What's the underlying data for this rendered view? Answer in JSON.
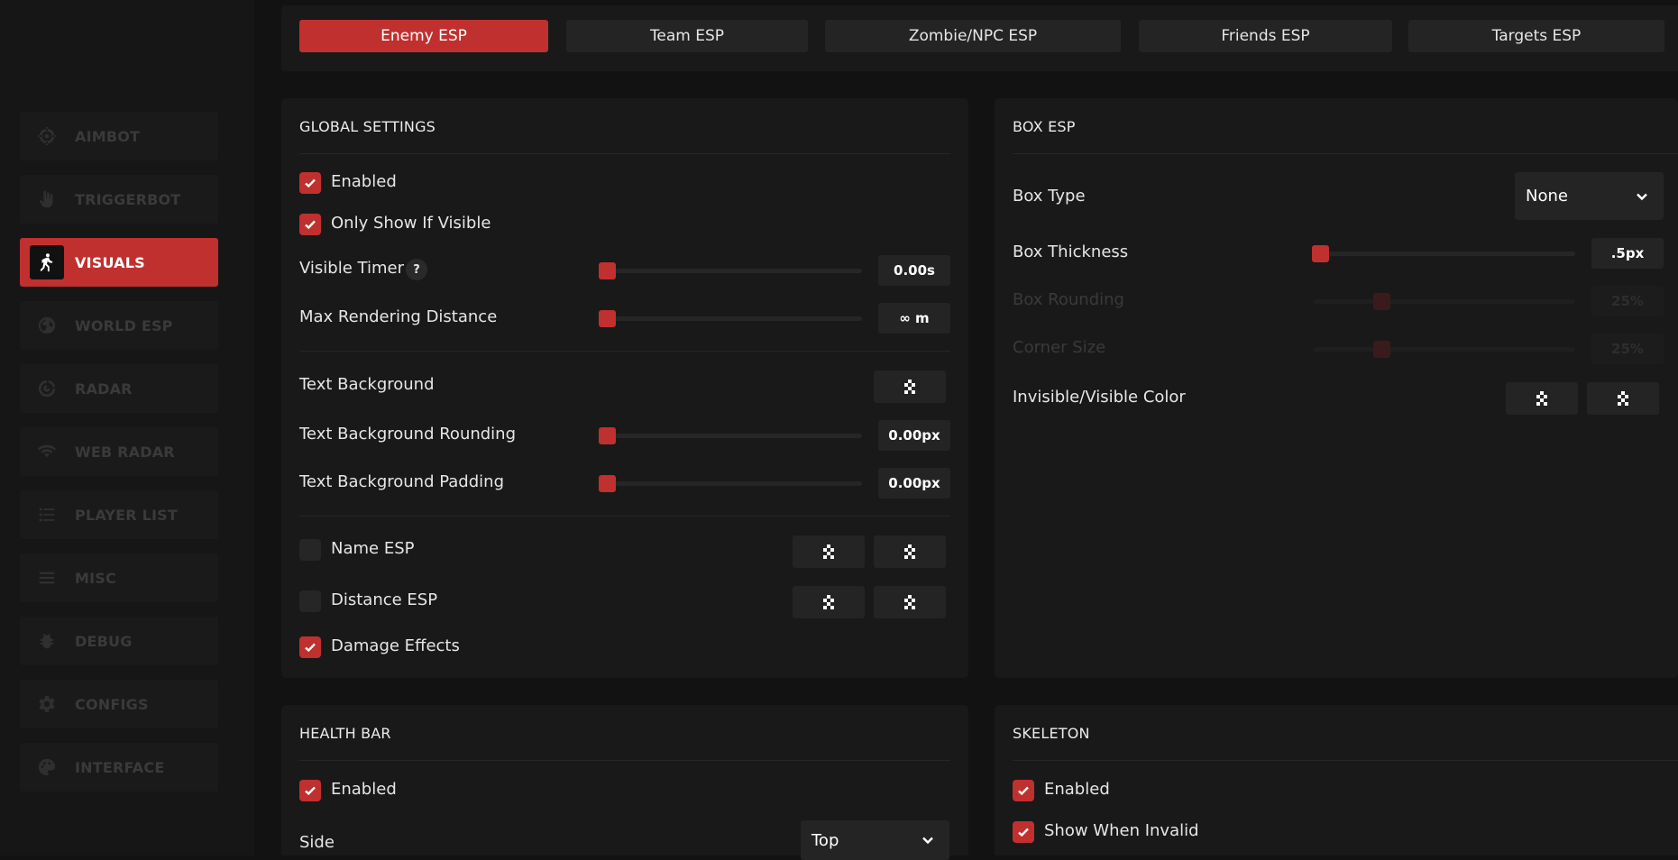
{
  "sidebar": {
    "items": [
      {
        "label": "AIMBOT",
        "icon": "crosshair-icon"
      },
      {
        "label": "TRIGGERBOT",
        "icon": "trigger-hand-icon"
      },
      {
        "label": "VISUALS",
        "icon": "walking-person-icon",
        "active": true
      },
      {
        "label": "WORLD ESP",
        "icon": "globe-icon"
      },
      {
        "label": "RADAR",
        "icon": "radar-icon"
      },
      {
        "label": "WEB RADAR",
        "icon": "wifi-icon"
      },
      {
        "label": "PLAYER LIST",
        "icon": "list-icon"
      },
      {
        "label": "MISC",
        "icon": "menu-lines-icon"
      },
      {
        "label": "DEBUG",
        "icon": "bug-icon"
      },
      {
        "label": "CONFIGS",
        "icon": "gear-icon"
      },
      {
        "label": "INTERFACE",
        "icon": "palette-icon"
      }
    ]
  },
  "tabs": [
    {
      "label": "Enemy ESP",
      "active": true
    },
    {
      "label": "Team ESP"
    },
    {
      "label": "Zombie/NPC ESP"
    },
    {
      "label": "Friends ESP"
    },
    {
      "label": "Targets ESP"
    }
  ],
  "global_settings": {
    "title": "GLOBAL SETTINGS",
    "enabled": {
      "label": "Enabled",
      "checked": true
    },
    "only_show_if_visible": {
      "label": "Only Show If Visible",
      "checked": true
    },
    "visible_timer": {
      "label": "Visible Timer",
      "help": "?",
      "value": "0.00s",
      "fraction": 0
    },
    "max_rendering_distance": {
      "label": "Max Rendering Distance",
      "value": "∞ m",
      "fraction": 0
    },
    "text_background": {
      "label": "Text Background"
    },
    "text_background_rounding": {
      "label": "Text Background Rounding",
      "value": "0.00px",
      "fraction": 0
    },
    "text_background_padding": {
      "label": "Text Background Padding",
      "value": "0.00px",
      "fraction": 0
    },
    "name_esp": {
      "label": "Name ESP",
      "checked": false
    },
    "distance_esp": {
      "label": "Distance ESP",
      "checked": false
    },
    "damage_effects": {
      "label": "Damage Effects",
      "checked": true
    }
  },
  "box_esp": {
    "title": "BOX ESP",
    "box_type": {
      "label": "Box Type",
      "value": "None"
    },
    "box_thickness": {
      "label": "Box Thickness",
      "value": ".5px",
      "fraction": 0
    },
    "box_rounding": {
      "label": "Box Rounding",
      "value": "25%",
      "fraction": 0.25,
      "disabled": true
    },
    "corner_size": {
      "label": "Corner Size",
      "value": "25%",
      "fraction": 0.25,
      "disabled": true
    },
    "color": {
      "label": "Invisible/Visible Color"
    }
  },
  "health_bar": {
    "title": "HEALTH BAR",
    "enabled": {
      "label": "Enabled",
      "checked": true
    },
    "side": {
      "label": "Side",
      "value": "Top"
    }
  },
  "skeleton": {
    "title": "SKELETON",
    "enabled": {
      "label": "Enabled",
      "checked": true
    },
    "show_when_invalid": {
      "label": "Show When Invalid",
      "checked": true
    }
  },
  "colors": {
    "accent": "#c0302f",
    "panel": "#191919",
    "control": "#242424"
  }
}
